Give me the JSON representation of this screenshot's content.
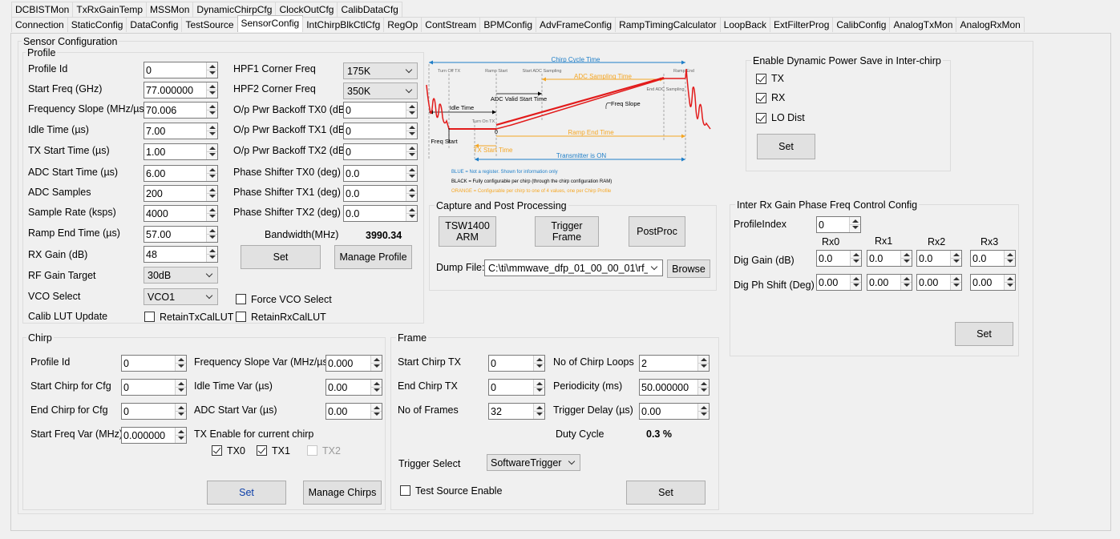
{
  "tabs_row1": [
    "DCBISTMon",
    "TxRxGainTemp",
    "MSSMon",
    "DynamicChirpCfg",
    "ClockOutCfg",
    "CalibDataCfg"
  ],
  "tabs_row2": [
    "Connection",
    "StaticConfig",
    "DataConfig",
    "TestSource",
    "SensorConfig",
    "IntChirpBlkCtlCfg",
    "RegOp",
    "ContStream",
    "BPMConfig",
    "AdvFrameConfig",
    "RampTimingCalculator",
    "LoopBack",
    "ExtFilterProg",
    "CalibConfig",
    "AnalogTxMon",
    "AnalogRxMon"
  ],
  "active_tab": "SensorConfig",
  "sensor_config": {
    "title": "Sensor Configuration"
  },
  "profile": {
    "title": "Profile",
    "profile_id": {
      "label": "Profile Id",
      "value": "0"
    },
    "start_freq": {
      "label": "Start Freq (GHz)",
      "value": "77.000000"
    },
    "freq_slope": {
      "label": "Frequency Slope (MHz/µs)",
      "value": "70.006"
    },
    "idle_time": {
      "label": "Idle Time (µs)",
      "value": "7.00"
    },
    "tx_start_time": {
      "label": "TX Start Time (µs)",
      "value": "1.00"
    },
    "adc_start_time": {
      "label": "ADC Start Time (µs)",
      "value": "6.00"
    },
    "adc_samples": {
      "label": "ADC Samples",
      "value": "200"
    },
    "sample_rate": {
      "label": "Sample Rate (ksps)",
      "value": "4000"
    },
    "ramp_end_time": {
      "label": "Ramp End Time (µs)",
      "value": "57.00"
    },
    "rx_gain": {
      "label": "RX Gain (dB)",
      "value": "48"
    },
    "rf_gain_target": {
      "label": "RF Gain Target",
      "value": "30dB"
    },
    "vco_select": {
      "label": "VCO Select",
      "value": "VCO1"
    },
    "calib_lut_update": {
      "label": "Calib LUT Update"
    },
    "retain_tx": {
      "label": "RetainTxCalLUT",
      "checked": false
    },
    "retain_rx": {
      "label": "RetainRxCalLUT",
      "checked": false
    },
    "force_vco": {
      "label": "Force VCO Select",
      "checked": false
    },
    "hpf1": {
      "label": "HPF1 Corner Freq",
      "value": "175K"
    },
    "hpf2": {
      "label": "HPF2 Corner Freq",
      "value": "350K"
    },
    "backoff_tx0": {
      "label": "O/p Pwr Backoff TX0 (dB)",
      "value": "0"
    },
    "backoff_tx1": {
      "label": "O/p Pwr Backoff TX1 (dB)",
      "value": "0"
    },
    "backoff_tx2": {
      "label": "O/p Pwr Backoff TX2 (dB)",
      "value": "0"
    },
    "phase_tx0": {
      "label": "Phase Shifter TX0 (deg)",
      "value": "0.0"
    },
    "phase_tx1": {
      "label": "Phase Shifter TX1 (deg)",
      "value": "0.0"
    },
    "phase_tx2": {
      "label": "Phase Shifter TX2 (deg)",
      "value": "0.0"
    },
    "bandwidth": {
      "label": "Bandwidth(MHz)",
      "value": "3990.34"
    },
    "set_label": "Set",
    "manage_label": "Manage Profile"
  },
  "diagram": {
    "chirp_cycle": "Chirp Cycle Time",
    "turn_off_tx": "Turn Off TX",
    "ramp_start": "Ramp Start",
    "start_adc": "Start ADC Sampling",
    "ramp_end": "Ramp End",
    "adc_sampling_time": "ADC Sampling Time",
    "end_adc": "End ADC Sampling",
    "adc_valid": "ADC Valid Start Time",
    "idle_time": "Idle Time",
    "freq_slope": "Freq Slope",
    "turn_on_tx": "Turn On TX",
    "zero": "0",
    "freq_start": "Freq Start",
    "ramp_end_time": "Ramp End Time",
    "tx_start_time": "TX Start Time",
    "transmitter_on": "Transmitter is ON",
    "legend_blue": "BLUE = Not a register. Shown for information only",
    "legend_black": "BLACK = Fully configurable per chirp (through the chirp configuration RAM)",
    "legend_orange": "ORANGE = Configurable per chirp to one of 4 values, one per Chirp Profile",
    "colors": {
      "blue": "#1e7ec8",
      "orange": "#f5a623",
      "red": "#e21b1b"
    }
  },
  "capture": {
    "title": "Capture and Post Processing",
    "tsw_label": "TSW1400\nARM",
    "trigger_label": "Trigger\nFrame",
    "postproc_label": "PostProc",
    "dump_label": "Dump File:",
    "dump_value": "C:\\ti\\mmwave_dfp_01_00_00_01\\rf_",
    "browse_label": "Browse"
  },
  "power_save": {
    "title": "Enable Dynamic Power Save in Inter-chirp",
    "tx": {
      "label": "TX",
      "checked": true
    },
    "rx": {
      "label": "RX",
      "checked": true
    },
    "lo": {
      "label": "LO Dist",
      "checked": true
    },
    "set_label": "Set"
  },
  "inter_rx": {
    "title": "Inter Rx Gain Phase Freq Control Config",
    "profile_index_label": "ProfileIndex",
    "profile_index_value": "0",
    "cols": [
      "Rx0",
      "Rx1",
      "Rx2",
      "Rx3"
    ],
    "dig_gain_label": "Dig Gain (dB)",
    "dig_gain": [
      "0.0",
      "0.0",
      "0.0",
      "0.0"
    ],
    "dig_ph_label": "Dig Ph Shift (Deg)",
    "dig_ph": [
      "0.00",
      "0.00",
      "0.00",
      "0.00"
    ],
    "set_label": "Set"
  },
  "chirp": {
    "title": "Chirp",
    "profile_id": {
      "label": "Profile Id",
      "value": "0"
    },
    "start_chirp": {
      "label": "Start Chirp for Cfg",
      "value": "0"
    },
    "end_chirp": {
      "label": "End Chirp for Cfg",
      "value": "0"
    },
    "start_freq_var": {
      "label": "Start Freq Var (MHz)",
      "value": "0.000000"
    },
    "freq_slope_var": {
      "label": "Frequency Slope Var (MHz/µs)",
      "value": "0.000"
    },
    "idle_time_var": {
      "label": "Idle Time Var (µs)",
      "value": "0.00"
    },
    "adc_start_var": {
      "label": "ADC Start Var (µs)",
      "value": "0.00"
    },
    "tx_enable": {
      "label": "TX Enable for current chirp"
    },
    "tx0": {
      "label": "TX0",
      "checked": true
    },
    "tx1": {
      "label": "TX1",
      "checked": true
    },
    "tx2": {
      "label": "TX2",
      "checked": false
    },
    "set_label": "Set",
    "manage_label": "Manage Chirps"
  },
  "frame": {
    "title": "Frame",
    "start_chirp_tx": {
      "label": "Start Chirp TX",
      "value": "0"
    },
    "end_chirp_tx": {
      "label": "End Chirp TX",
      "value": "0"
    },
    "no_frames": {
      "label": "No of Frames",
      "value": "32"
    },
    "no_loops": {
      "label": "No of Chirp Loops",
      "value": "2"
    },
    "periodicity": {
      "label": "Periodicity (ms)",
      "value": "50.000000"
    },
    "trigger_delay": {
      "label": "Trigger Delay (µs)",
      "value": "0.00"
    },
    "duty_cycle": {
      "label": "Duty Cycle",
      "value": "0.3 %"
    },
    "trigger_select": {
      "label": "Trigger Select",
      "value": "SoftwareTrigger"
    },
    "test_source": {
      "label": "Test Source Enable",
      "checked": false
    },
    "set_label": "Set"
  }
}
